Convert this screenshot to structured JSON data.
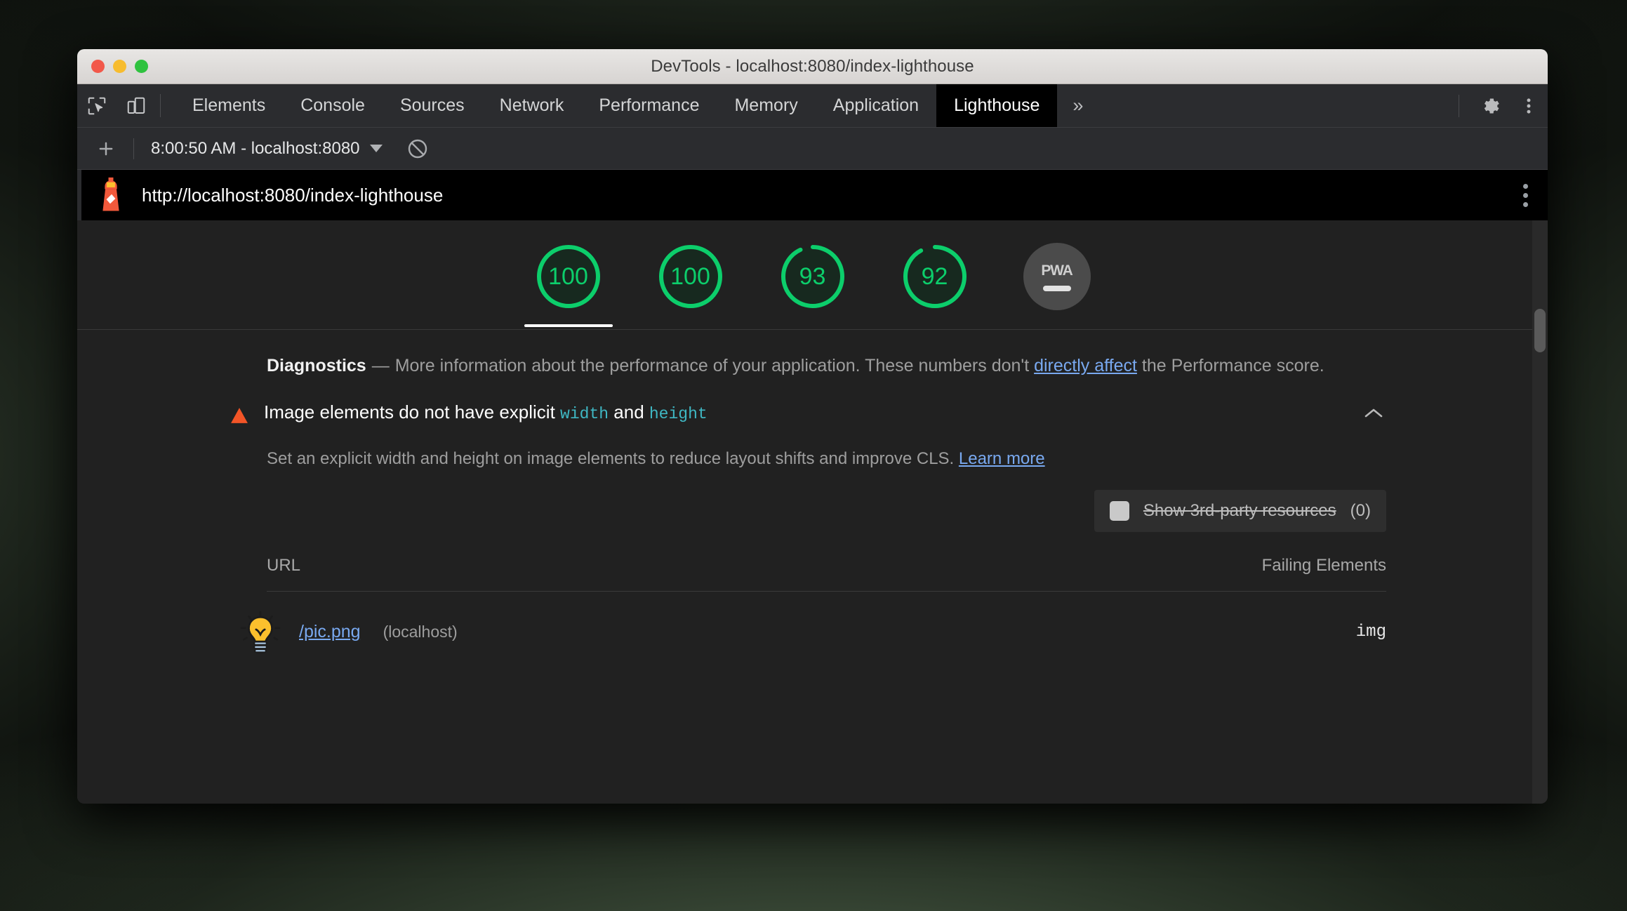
{
  "window": {
    "title": "DevTools - localhost:8080/index-lighthouse",
    "traffic_lights": [
      "close",
      "minimize",
      "maximize"
    ]
  },
  "devtools_toolbar": {
    "inspect_icon": "inspect-element-icon",
    "device_icon": "device-toolbar-icon",
    "tabs": [
      {
        "label": "Elements",
        "active": false
      },
      {
        "label": "Console",
        "active": false
      },
      {
        "label": "Sources",
        "active": false
      },
      {
        "label": "Network",
        "active": false
      },
      {
        "label": "Performance",
        "active": false
      },
      {
        "label": "Memory",
        "active": false
      },
      {
        "label": "Application",
        "active": false
      },
      {
        "label": "Lighthouse",
        "active": true
      }
    ],
    "more_tabs_label": "»",
    "settings_icon": "gear-icon",
    "main_menu_icon": "three-dot-menu-icon"
  },
  "lighthouse_toolbar": {
    "add_label": "+",
    "run_selector_value": "8:00:50 AM - localhost:8080",
    "clear_icon": "clear-icon"
  },
  "report": {
    "logo": "lighthouse-logo",
    "url": "http://localhost:8080/index-lighthouse",
    "menu_icon": "three-dot-menu-icon",
    "gauges": [
      {
        "score": "100",
        "selected": true,
        "percent": 100
      },
      {
        "score": "100",
        "selected": false,
        "percent": 100
      },
      {
        "score": "93",
        "selected": false,
        "percent": 93
      },
      {
        "score": "92",
        "selected": false,
        "percent": 92
      }
    ],
    "pwa": {
      "label": "PWA",
      "state": "not-applicable"
    },
    "diagnostics": {
      "title": "Diagnostics",
      "dash": "—",
      "text_before_link": "More information about the performance of your application. These numbers don't ",
      "link_text": "directly affect",
      "text_after_link": " the Performance score."
    },
    "audit": {
      "severity_icon": "warning-triangle-icon",
      "title_part1": "Image elements do not have explicit ",
      "title_code1": "width",
      "title_part2": " and ",
      "title_code2": "height",
      "collapse_icon": "chevron-up-icon",
      "description": "Set an explicit width and height on image elements to reduce layout shifts and improve CLS. ",
      "description_link": "Learn more",
      "third_party": {
        "checkbox_state": "unchecked",
        "label": "Show 3rd-party resources",
        "count": "(0)"
      },
      "table": {
        "headers": [
          "URL",
          "Failing Elements"
        ],
        "rows": [
          {
            "thumbnail": "lightbulb-thumbnail",
            "url": "/pic.png",
            "host": "(localhost)",
            "failing_element": "img"
          }
        ]
      }
    }
  },
  "colors": {
    "score_green": "#0cce6b",
    "link_blue": "#79a9f0",
    "code_cyan": "#3fb7c3",
    "warning_orange": "#f35527",
    "panel_bg": "#212121",
    "toolbar_bg": "#2b2c2f"
  }
}
